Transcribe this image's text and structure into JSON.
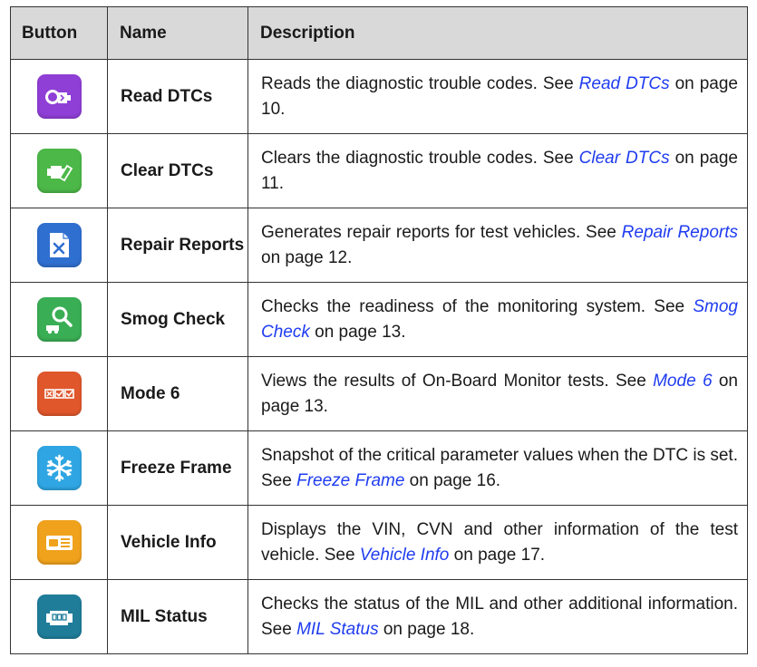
{
  "table": {
    "headers": {
      "button": "Button",
      "name": "Name",
      "description": "Description"
    },
    "rows": [
      {
        "icon": "read-dtcs-icon",
        "icon_color": "#8f3fd6",
        "name": "Read DTCs",
        "desc_before": "Reads the diagnostic trouble codes. See ",
        "link": "Read DTCs",
        "desc_after": " on page 10."
      },
      {
        "icon": "clear-dtcs-icon",
        "icon_color": "#4cb848",
        "name": "Clear DTCs",
        "desc_before": "Clears the diagnostic trouble codes. See ",
        "link": "Clear DTCs",
        "desc_after": " on page 11."
      },
      {
        "icon": "repair-reports-icon",
        "icon_color": "#2f6fd0",
        "name": "Repair Reports",
        "desc_before": "Generates repair reports for test vehicles. See ",
        "link": "Repair Reports",
        "desc_after": " on page 12."
      },
      {
        "icon": "smog-check-icon",
        "icon_color": "#3aae55",
        "name": "Smog Check",
        "desc_before": "Checks the readiness of the monitoring system. See ",
        "link": "Smog Check",
        "desc_after": " on page 13."
      },
      {
        "icon": "mode-6-icon",
        "icon_color": "#e0572b",
        "name": "Mode 6",
        "desc_before": "Views the results of On-Board Monitor tests. See ",
        "link": "Mode 6",
        "desc_after": " on page 13."
      },
      {
        "icon": "freeze-frame-icon",
        "icon_color": "#2fa6e3",
        "name": "Freeze Frame",
        "desc_before": "Snapshot of the critical parameter values when the DTC is set. See ",
        "link": "Freeze Frame",
        "desc_after": " on page 16."
      },
      {
        "icon": "vehicle-info-icon",
        "icon_color": "#f0a21c",
        "name": "Vehicle Info",
        "desc_before": "Displays the VIN, CVN and other information of the test vehicle. See ",
        "link": "Vehicle Info",
        "desc_after": " on page 17."
      },
      {
        "icon": "mil-status-icon",
        "icon_color": "#1f7d9a",
        "name": "MIL Status",
        "desc_before": "Checks the status of the MIL and other additional information. See ",
        "link": "MIL Status",
        "desc_after": " on page 18."
      }
    ]
  }
}
